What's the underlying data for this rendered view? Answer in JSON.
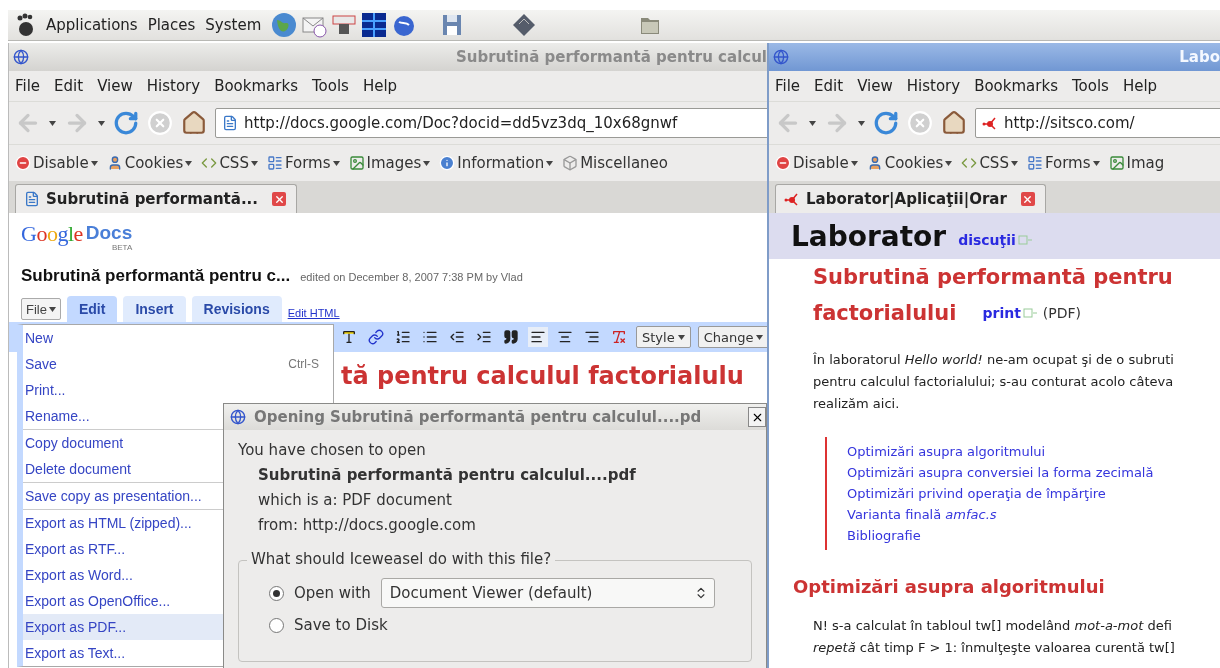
{
  "panel": {
    "menus": [
      "Applications",
      "Places",
      "System"
    ]
  },
  "left_window": {
    "active": false,
    "title": "Subrutină performantă pentru calcul",
    "menu": [
      "File",
      "Edit",
      "View",
      "History",
      "Bookmarks",
      "Tools",
      "Help"
    ],
    "url": "http://docs.google.com/Doc?docid=dd5vz3dq_10x68gnwf",
    "devbar": [
      {
        "label": "Disable",
        "caret": true
      },
      {
        "label": "Cookies",
        "caret": true
      },
      {
        "label": "CSS",
        "caret": true
      },
      {
        "label": "Forms",
        "caret": true
      },
      {
        "label": "Images",
        "caret": true
      },
      {
        "label": "Information",
        "caret": true
      },
      {
        "label": "Miscellaneo",
        "caret": false
      }
    ],
    "tab": {
      "label": "Subrutină performantă...",
      "selected": true
    },
    "docs": {
      "logo": "Google",
      "product": "Docs",
      "badge": "BETA",
      "doc_title": "Subrutină performantă pentru c...",
      "edited": "edited on December 8, 2007 7:38 PM by Vlad",
      "file_button": "File",
      "tabs": [
        {
          "label": "Edit",
          "selected": true
        },
        {
          "label": "Insert",
          "selected": false
        },
        {
          "label": "Revisions",
          "selected": false
        }
      ],
      "edit_html": "Edit HTML",
      "style_buttons": [
        "Style",
        "Change"
      ],
      "heading": "tă pentru calculul factorialulu"
    }
  },
  "file_menu": {
    "groups": [
      [
        {
          "label": "New",
          "selected": false
        },
        {
          "label": "Save",
          "shortcut": "Ctrl-S",
          "selected": false
        },
        {
          "label": "Print...",
          "selected": false
        },
        {
          "label": "Rename...",
          "selected": false
        }
      ],
      [
        {
          "label": "Copy document",
          "selected": false
        },
        {
          "label": "Delete document",
          "selected": false
        }
      ],
      [
        {
          "label": "Save copy as presentation...",
          "selected": false
        }
      ],
      [
        {
          "label": "Export as HTML (zipped)...",
          "selected": false
        },
        {
          "label": "Export as RTF...",
          "selected": false
        },
        {
          "label": "Export as Word...",
          "selected": false
        },
        {
          "label": "Export as OpenOffice...",
          "selected": false
        },
        {
          "label": "Export as PDF...",
          "selected": true
        },
        {
          "label": "Export as Text...",
          "selected": false
        }
      ]
    ]
  },
  "dialog": {
    "title": "Opening Subrutină performantă pentru calculul....pd",
    "intro": "You have chosen to open",
    "file_name": "Subrutină performantă pentru calculul....pdf",
    "file_type": "which is a: PDF document",
    "source": "from: http://docs.google.com",
    "question": "What should Iceweasel do with this file?",
    "options": [
      {
        "label": "Open with",
        "selected": true,
        "app": "Document Viewer (default)"
      },
      {
        "label": "Save to Disk",
        "selected": false
      }
    ]
  },
  "right_window": {
    "active": true,
    "title": "Labo",
    "menu": [
      "File",
      "Edit",
      "View",
      "History",
      "Bookmarks",
      "Tools",
      "Help"
    ],
    "url": "http://sitsco.com/",
    "devbar": [
      {
        "label": "Disable",
        "caret": true
      },
      {
        "label": "Cookies",
        "caret": true
      },
      {
        "label": "CSS",
        "caret": true
      },
      {
        "label": "Forms",
        "caret": true
      },
      {
        "label": "Imag",
        "caret": false
      }
    ],
    "tab": {
      "label": "Laborator|Aplicaţii|Orar",
      "selected": true
    },
    "page": {
      "site_title": "Laborator",
      "discuss_link": "discuţii",
      "heading_lines": [
        "Subrutină performantă pentru",
        "factorialului"
      ],
      "print_link": "print",
      "print_note": "(PDF)",
      "intro_lines": [
        "În laboratorul *Hello world!* ne-am ocupat şi de o subruti",
        "pentru calculul factorialului; s-au conturat acolo câteva",
        "realizăm aici."
      ],
      "toc": [
        "Optimizări asupra algoritmului",
        "Optimizări asupra conversiei la forma zecimală",
        "Optimizări privind operaţia de împărţire",
        "Varianta finală *amfac.s*",
        "Bibliografie"
      ],
      "section_heading": "Optimizări asupra algoritmului",
      "body_lines": [
        "N! s-a calculat în tabloul tw[] modelând *mot-a-mot* defi",
        "*repetă* cât timp F > 1: înmulţeşte valoarea curentă tw[]"
      ]
    }
  }
}
